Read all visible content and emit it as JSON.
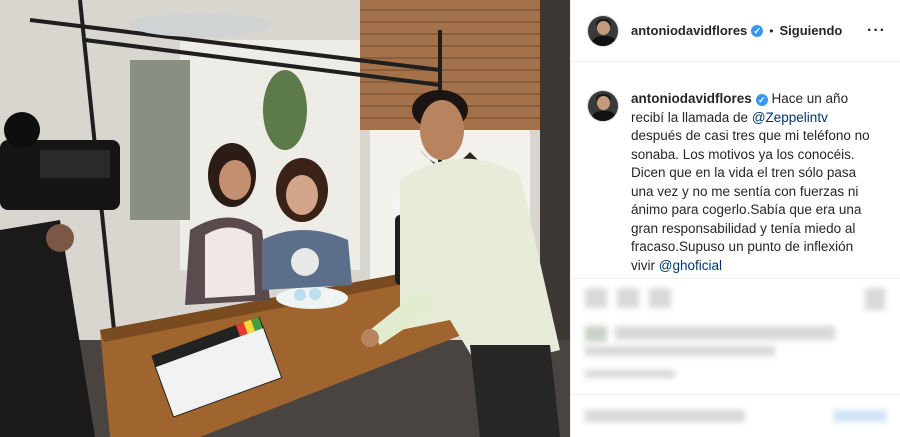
{
  "post": {
    "username": "antoniodavidflores",
    "follow_status": "Siguiendo",
    "separator": "•",
    "more_icon": "···",
    "verified_icon": "✓",
    "caption": {
      "username": "antoniodavidflores",
      "part1": " Hace un año recibí la llamada de ",
      "mention1": "@Zeppelintv",
      "part2": " después de casi tres que mi teléfono no sonaba. Los motivos ya los conocéis. Dicen que en la vida el tren sólo pasa una vez y no me sentía con fuerzas ni ánimo para cogerlo.Sabía que era una gran responsabilidad y tenía miedo al fracaso.Supuso un punto de inflexión vivir ",
      "mention2": "@ghoficial"
    }
  },
  "colors": {
    "accent": "#3897f0",
    "mention": "#003569"
  }
}
